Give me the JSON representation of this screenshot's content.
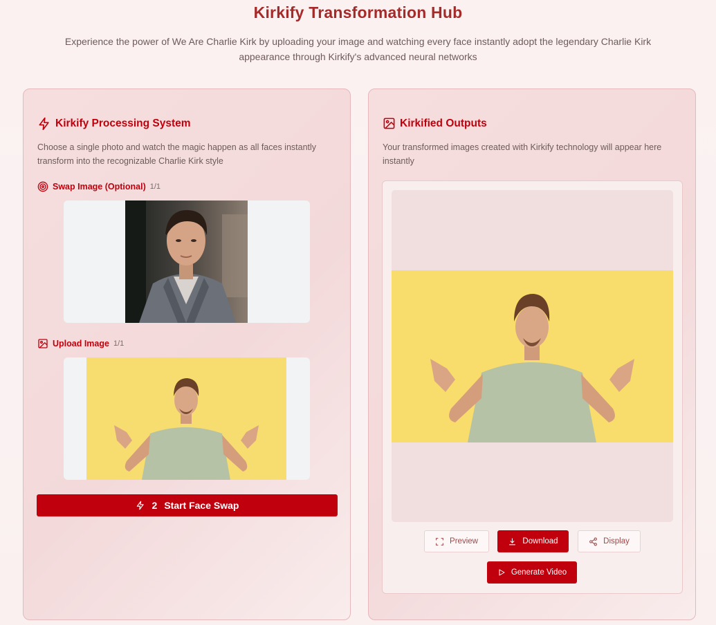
{
  "header": {
    "title": "Kirkify Transformation Hub",
    "subtitle": "Experience the power of We Are Charlie Kirk by uploading your image and watching every face instantly adopt the legendary Charlie Kirk appearance through Kirkify's advanced neural networks"
  },
  "left_panel": {
    "title": "Kirkify Processing System",
    "description": "Choose a single photo and watch the magic happen as all faces instantly transform into the recognizable Charlie Kirk style",
    "swap_image": {
      "label": "Swap Image (Optional)",
      "count": "1/1"
    },
    "upload_image": {
      "label": "Upload Image",
      "count": "1/1"
    },
    "start_button": {
      "number": "2",
      "label": "Start Face Swap"
    }
  },
  "right_panel": {
    "title": "Kirkified Outputs",
    "description": "Your transformed images created with Kirkify technology will appear here instantly",
    "buttons": {
      "preview": "Preview",
      "download": "Download",
      "display": "Display",
      "generate_video": "Generate Video"
    }
  },
  "colors": {
    "accent": "#c0000c",
    "title": "#a52a2a"
  }
}
